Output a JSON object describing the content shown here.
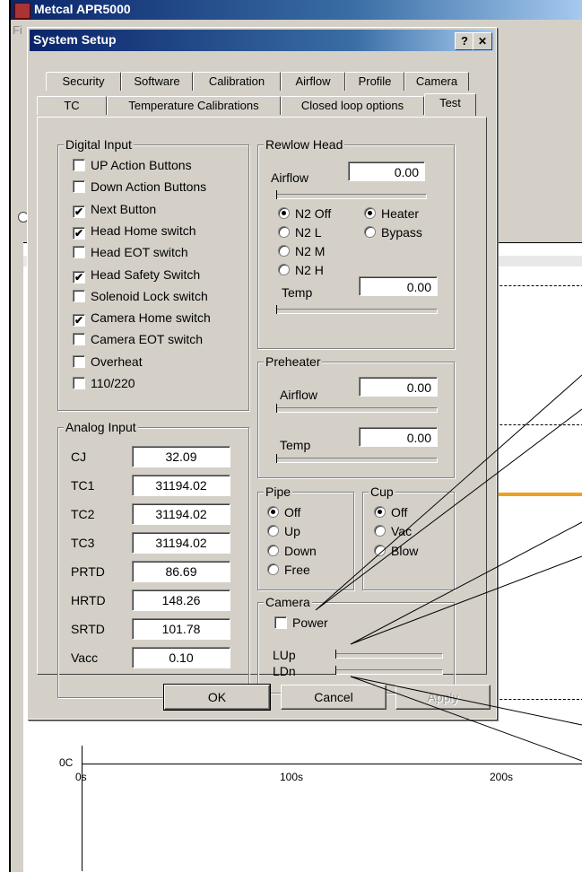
{
  "main_window": {
    "title": "Metcal APR5000",
    "menu_fragment": "Fi",
    "axis": {
      "y_label": "0C",
      "x_ticks": [
        "0s",
        "100s",
        "200s"
      ]
    }
  },
  "dialog": {
    "title": "System Setup",
    "help_button": "?",
    "close_button": "✕",
    "tabs_row1": [
      "Security",
      "Software",
      "Calibration",
      "Airflow",
      "Profile",
      "Camera"
    ],
    "tabs_row2": [
      "TC",
      "Temperature Calibrations",
      "Closed loop options",
      "Test"
    ],
    "active_tab": "Test",
    "digital_input": {
      "title": "Digital Input",
      "items": [
        {
          "label": "UP Action Buttons",
          "checked": false
        },
        {
          "label": "Down Action Buttons",
          "checked": false
        },
        {
          "label": "Next Button",
          "checked": true
        },
        {
          "label": "Head Home switch",
          "checked": true
        },
        {
          "label": "Head EOT switch",
          "checked": false
        },
        {
          "label": "Head Safety Switch",
          "checked": true
        },
        {
          "label": "Solenoid Lock switch",
          "checked": false
        },
        {
          "label": "Camera Home switch",
          "checked": true
        },
        {
          "label": "Camera EOT switch",
          "checked": false
        },
        {
          "label": "Overheat",
          "checked": false
        },
        {
          "label": "110/220",
          "checked": false
        }
      ]
    },
    "analog_input": {
      "title": "Analog Input",
      "rows": [
        {
          "label": "CJ",
          "value": "32.09"
        },
        {
          "label": "TC1",
          "value": "31194.02"
        },
        {
          "label": "TC2",
          "value": "31194.02"
        },
        {
          "label": "TC3",
          "value": "31194.02"
        },
        {
          "label": "PRTD",
          "value": "86.69"
        },
        {
          "label": "HRTD",
          "value": "148.26"
        },
        {
          "label": "SRTD",
          "value": "101.78"
        },
        {
          "label": "Vacc",
          "value": "0.10"
        }
      ]
    },
    "reflow_head": {
      "title": "Rewlow Head",
      "airflow_label": "Airflow",
      "airflow_value": "0.00",
      "gas_options": [
        {
          "label": "N2 Off",
          "selected": true
        },
        {
          "label": "N2 L",
          "selected": false
        },
        {
          "label": "N2 M",
          "selected": false
        },
        {
          "label": "N2 H",
          "selected": false
        }
      ],
      "mode_options": [
        {
          "label": "Heater",
          "selected": true
        },
        {
          "label": "Bypass",
          "selected": false
        }
      ],
      "temp_label": "Temp",
      "temp_value": "0.00"
    },
    "preheater": {
      "title": "Preheater",
      "airflow_label": "Airflow",
      "airflow_value": "0.00",
      "temp_label": "Temp",
      "temp_value": "0.00"
    },
    "pipe": {
      "title": "Pipe",
      "options": [
        {
          "label": "Off",
          "selected": true
        },
        {
          "label": "Up",
          "selected": false
        },
        {
          "label": "Down",
          "selected": false
        },
        {
          "label": "Free",
          "selected": false
        }
      ]
    },
    "cup": {
      "title": "Cup",
      "options": [
        {
          "label": "Off",
          "selected": true
        },
        {
          "label": "Vac",
          "selected": false
        },
        {
          "label": "Blow",
          "selected": false
        }
      ]
    },
    "camera": {
      "title": "Camera",
      "power_label": "Power",
      "power_checked": false,
      "lup_label": "LUp",
      "ldn_label": "LDn"
    },
    "buttons": {
      "ok": "OK",
      "cancel": "Cancel",
      "apply": "Apply"
    }
  }
}
